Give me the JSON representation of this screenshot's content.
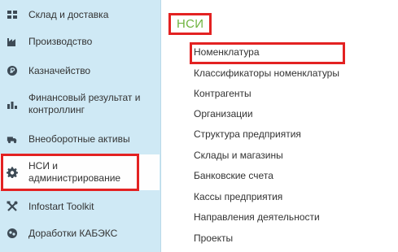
{
  "colors": {
    "sidebar_bg": "#cfe9f5",
    "active_bg": "#fefefe",
    "highlight": "#e32222",
    "section_title": "#6fb43f",
    "text": "#333333"
  },
  "sidebar": {
    "items": [
      {
        "label": "Склад и доставка",
        "icon": "warehouse-icon"
      },
      {
        "label": "Производство",
        "icon": "factory-icon"
      },
      {
        "label": "Казначейство",
        "icon": "coin-icon"
      },
      {
        "label": "Финансовый результат и\nконтроллинг",
        "icon": "bar-chart-icon"
      },
      {
        "label": "Внеоборотные активы",
        "icon": "truck-icon"
      },
      {
        "label": "НСИ и\nадминистрирование",
        "icon": "gear-icon",
        "active": true
      },
      {
        "label": "Infostart Toolkit",
        "icon": "tools-icon"
      },
      {
        "label": "Доработки КАБЭКС",
        "icon": "puzzle-icon"
      }
    ]
  },
  "main": {
    "title": "НСИ",
    "links": [
      "Номенклатура",
      "Классификаторы номенклатуры",
      "Контрагенты",
      "Организации",
      "Структура предприятия",
      "Склады и магазины",
      "Банковские счета",
      "Кассы предприятия",
      "Направления деятельности",
      "Проекты"
    ]
  }
}
